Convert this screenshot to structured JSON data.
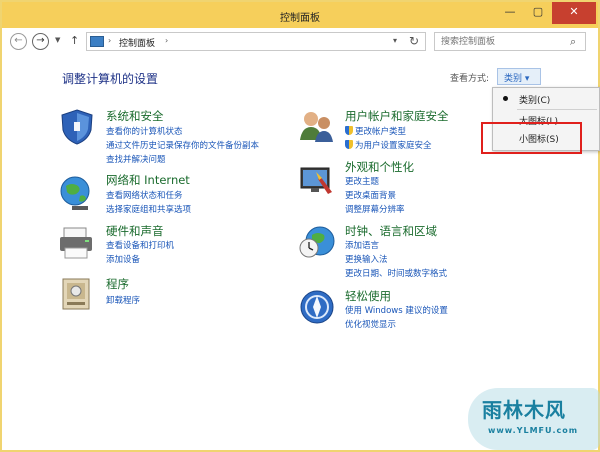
{
  "window": {
    "title": "控制面板",
    "minimize_glyph": "—",
    "maximize_glyph": "▢",
    "close_glyph": "✕"
  },
  "nav": {
    "back_icon": "back-arrow-icon",
    "forward_icon": "forward-arrow-icon",
    "up_icon": "up-arrow-icon",
    "address": "控制面板",
    "search_placeholder": "搜索控制面板"
  },
  "main": {
    "heading": "调整计算机的设置",
    "view_by_label": "查看方式:",
    "view_by_value": "类别 ▾"
  },
  "view_menu": {
    "items": [
      {
        "label": "类别(C)",
        "selected": true
      },
      {
        "label": "大图标(L)",
        "selected": false
      },
      {
        "label": "小图标(S)",
        "selected": false
      }
    ],
    "highlight_color": "#e0201c"
  },
  "categories": {
    "system": {
      "title": "系统和安全",
      "links": [
        "查看你的计算机状态",
        "通过文件历史记录保存你的文件备份副本",
        "查找并解决问题"
      ]
    },
    "network": {
      "title": "网络和 Internet",
      "links": [
        "查看网络状态和任务",
        "选择家庭组和共享选项"
      ]
    },
    "hardware": {
      "title": "硬件和声音",
      "links": [
        "查看设备和打印机",
        "添加设备"
      ]
    },
    "programs": {
      "title": "程序",
      "links": [
        "卸载程序"
      ]
    },
    "user": {
      "title": "用户帐户和家庭安全",
      "links": [
        "更改帐户类型",
        "为用户设置家庭安全"
      ]
    },
    "appearance": {
      "title": "外观和个性化",
      "links": [
        "更改主题",
        "更改桌面背景",
        "调整屏幕分辨率"
      ]
    },
    "clock": {
      "title": "时钟、语言和区域",
      "links": [
        "添加语言",
        "更换输入法",
        "更改日期、时间或数字格式"
      ]
    },
    "ease": {
      "title": "轻松使用",
      "links": [
        "使用 Windows 建议的设置",
        "优化视觉显示"
      ]
    }
  },
  "watermark": {
    "text": "雨林木风",
    "url": "www.YLMFU.com"
  },
  "colors": {
    "titlebar": "#f6cf5b",
    "close_button": "#c7402f",
    "category_title": "#1a6b2d",
    "link": "#1a56b8",
    "heading": "#1e3287"
  }
}
